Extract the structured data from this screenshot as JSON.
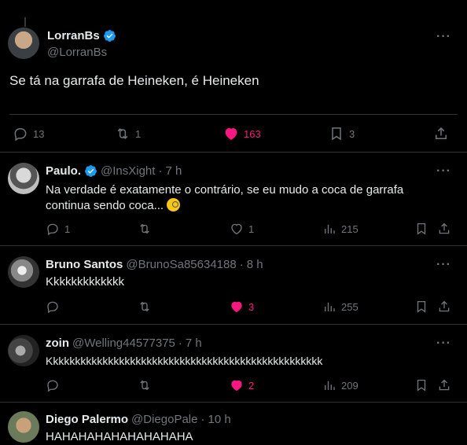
{
  "main": {
    "name": "LorranBs",
    "handle": "@LorranBs",
    "text": "Se tá na garrafa de Heineken, é Heineken",
    "replies": "13",
    "retweets": "1",
    "likes": "163",
    "bookmarks": "3"
  },
  "replies": [
    {
      "name": "Paulo.",
      "handle": "@InsXight",
      "time": "7 h",
      "verified": true,
      "text1": "Na verdade é exatamente o contrário, se eu mudo a coca de garrafa",
      "text2": "continua sendo coca...",
      "replies": "1",
      "retweets": "",
      "likes": "1",
      "views": "215",
      "liked": false
    },
    {
      "name": "Bruno Santos",
      "handle": "@BrunoSa85634188",
      "time": "8 h",
      "text1": "Kkkkkkkkkkkkk",
      "replies": "",
      "retweets": "",
      "likes": "3",
      "views": "255",
      "liked": true
    },
    {
      "name": "zoin",
      "handle": "@Welling44577375",
      "time": "7 h",
      "text1": "Kkkkkkkkkkkkkkkkkkkkkkkkkkkkkkkkkkkkkkkkkkkkkkkkkk",
      "replies": "",
      "retweets": "",
      "likes": "2",
      "views": "209",
      "liked": true
    },
    {
      "name": "Diego Palermo",
      "handle": "@DiegoPale",
      "time": "10 h",
      "text1": "HAHAHAHAHAHAHAHAHA"
    }
  ],
  "colors": {
    "accent_like": "#f91880",
    "verified": "#1d9bf0",
    "muted": "#71767b"
  }
}
